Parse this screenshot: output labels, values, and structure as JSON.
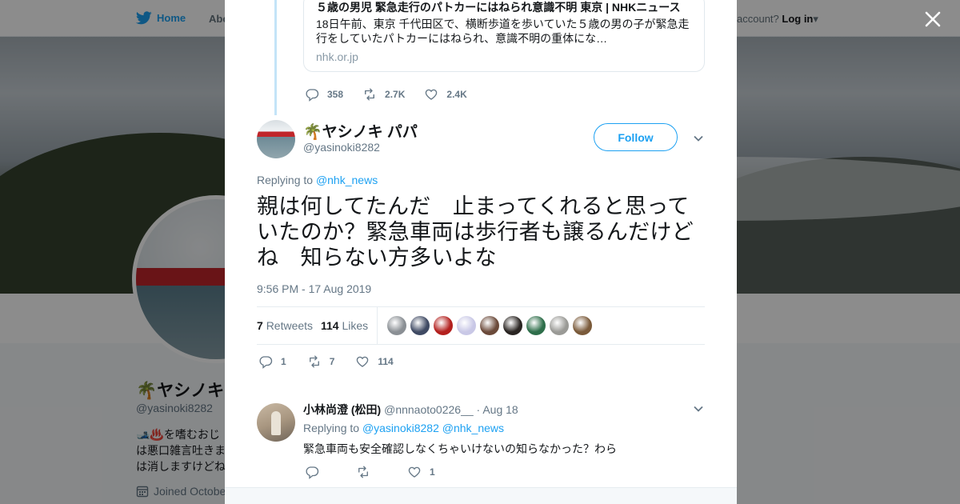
{
  "background": {
    "nav": {
      "home_label": "Home",
      "about_label": "Abo",
      "login_prompt": "account?",
      "login_label": "Log in"
    },
    "profile": {
      "name": "🌴ヤシノキ",
      "handle": "@yasinoki8282",
      "bio_line1": "🎿♨️を嗜むおじ",
      "bio_line2": "は悪口雑言吐きま",
      "bio_line3": "は消しますけどね",
      "joined": "Joined Octobe"
    }
  },
  "close_label": "Close",
  "quoted_card": {
    "title": "５歳の男児 緊急走行のパトカーにはねられ意識不明 東京 | NHKニュース",
    "description": "18日午前、東京 千代田区で、横断歩道を歩いていた５歳の男の子が緊急走行をしていたパトカーにはねられ、意識不明の重体にな…",
    "domain": "nhk.or.jp"
  },
  "parent_actions": {
    "replies": "358",
    "retweets": "2.7K",
    "likes": "2.4K"
  },
  "tweet": {
    "author_name": "🌴ヤシノキ パパ",
    "author_handle": "@yasinoki8282",
    "follow_label": "Follow",
    "replying_prefix": "Replying to",
    "replying_to": "@nhk_news",
    "text": "親は何してたんだ　止まってくれると思っていたのか？緊急車両は歩行者も譲るんだけどね　知らない方多いよな",
    "timestamp": "9:56 PM - 17 Aug 2019",
    "retweets_count": "7",
    "retweets_label": "Retweets",
    "likes_count": "114",
    "likes_label": "Likes",
    "actions": {
      "replies": "1",
      "retweets": "7",
      "likes": "114"
    }
  },
  "liker_colors": [
    "#8a8f94",
    "#3f4a63",
    "#b3201e",
    "#c9c8e6",
    "#6b4a3a",
    "#2a2522",
    "#2e6e4a",
    "#9a9a96",
    "#7a5a3a"
  ],
  "reply": {
    "author_name": "小林尚澄 (松田)",
    "author_handle": "@nnnaoto0226__",
    "date": "· Aug 18",
    "replying_prefix": "Replying to",
    "replying_to_1": "@yasinoki8282",
    "replying_to_2": "@nhk_news",
    "text": "緊急車両も安全確認しなくちゃいけないの知らなかった？わら",
    "actions": {
      "likes": "1"
    }
  },
  "colors": {
    "accent": "#1da1f2",
    "text": "#14171a",
    "secondary": "#657786"
  }
}
